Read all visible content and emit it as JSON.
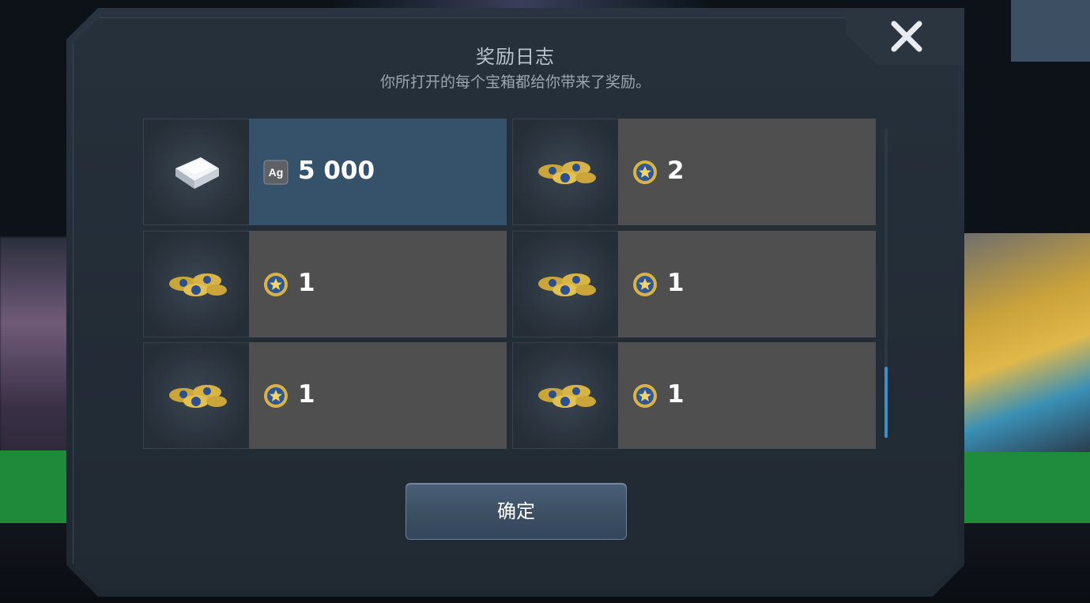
{
  "dialog": {
    "title": "奖励日志",
    "subtitle": "你所打开的每个宝箱都给你带来了奖励。",
    "confirm_label": "确定"
  },
  "rewards": [
    {
      "item_icon": "silver-bar-icon",
      "currency_icon": "silver-ag-icon",
      "currency_label": "Ag",
      "amount": "5 000",
      "selected": true
    },
    {
      "item_icon": "medal-pile-icon",
      "currency_icon": "star-medal-icon",
      "amount": "2",
      "selected": false
    },
    {
      "item_icon": "medal-pile-icon",
      "currency_icon": "star-medal-icon",
      "amount": "1",
      "selected": false
    },
    {
      "item_icon": "medal-pile-icon",
      "currency_icon": "star-medal-icon",
      "amount": "1",
      "selected": false
    },
    {
      "item_icon": "medal-pile-icon",
      "currency_icon": "star-medal-icon",
      "amount": "1",
      "selected": false
    },
    {
      "item_icon": "medal-pile-icon",
      "currency_icon": "star-medal-icon",
      "amount": "1",
      "selected": false
    }
  ],
  "colors": {
    "selected_row": "#35526a",
    "row": "#4f4f4f",
    "scroll_thumb": "#3f8fc7"
  }
}
